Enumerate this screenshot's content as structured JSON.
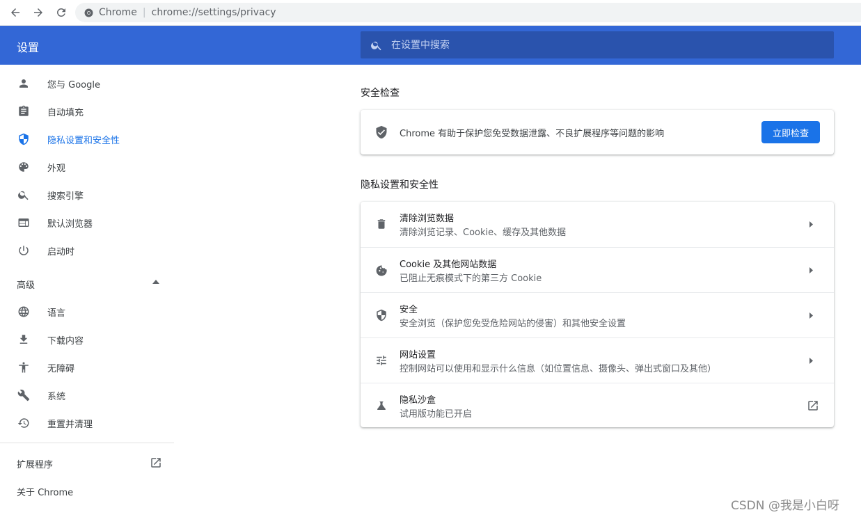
{
  "browser": {
    "origin": "Chrome",
    "url": "chrome://settings/privacy"
  },
  "header": {
    "title": "设置",
    "search_placeholder": "在设置中搜索"
  },
  "sidebar": {
    "items": [
      {
        "label": "您与 Google",
        "icon": "person-icon"
      },
      {
        "label": "自动填充",
        "icon": "clipboard-icon"
      },
      {
        "label": "隐私设置和安全性",
        "icon": "shield-icon",
        "active": true
      },
      {
        "label": "外观",
        "icon": "palette-icon"
      },
      {
        "label": "搜索引擎",
        "icon": "search-icon"
      },
      {
        "label": "默认浏览器",
        "icon": "browser-icon"
      },
      {
        "label": "启动时",
        "icon": "power-icon"
      }
    ],
    "advanced_label": "高级",
    "advanced_items": [
      {
        "label": "语言",
        "icon": "globe-icon"
      },
      {
        "label": "下载内容",
        "icon": "download-icon"
      },
      {
        "label": "无障碍",
        "icon": "accessibility-icon"
      },
      {
        "label": "系统",
        "icon": "wrench-icon"
      },
      {
        "label": "重置并清理",
        "icon": "history-icon"
      }
    ],
    "extensions_label": "扩展程序",
    "about_label": "关于 Chrome"
  },
  "safety_check": {
    "section_title": "安全检查",
    "description": "Chrome 有助于保护您免受数据泄露、不良扩展程序等问题的影响",
    "button_label": "立即检查"
  },
  "privacy": {
    "section_title": "隐私设置和安全性",
    "rows": [
      {
        "title": "清除浏览数据",
        "subtitle": "清除浏览记录、Cookie、缓存及其他数据",
        "icon": "trash-icon"
      },
      {
        "title": "Cookie 及其他网站数据",
        "subtitle": "已阻止无痕模式下的第三方 Cookie",
        "icon": "cookie-icon"
      },
      {
        "title": "安全",
        "subtitle": "安全浏览（保护您免受危险网站的侵害）和其他安全设置",
        "icon": "shield-icon"
      },
      {
        "title": "网站设置",
        "subtitle": "控制网站可以使用和显示什么信息（如位置信息、摄像头、弹出式窗口及其他）",
        "icon": "tune-icon"
      },
      {
        "title": "隐私沙盒",
        "subtitle": "试用版功能已开启",
        "icon": "flask-icon"
      }
    ]
  },
  "watermark": "CSDN @我是小白呀",
  "colors": {
    "header_bg": "#3367d6",
    "search_bg": "#2a53ad",
    "accent": "#1a73e8"
  }
}
